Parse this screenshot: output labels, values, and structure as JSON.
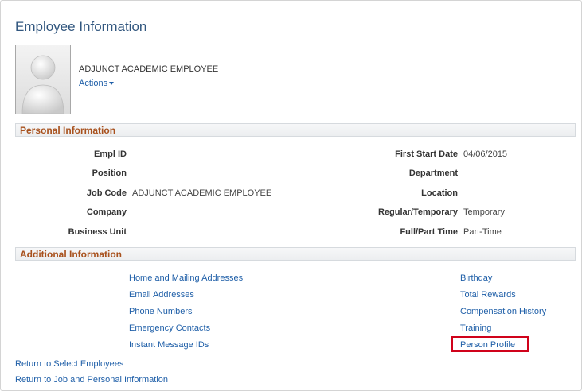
{
  "page": {
    "title": "Employee Information"
  },
  "employee": {
    "name": "ADJUNCT ACADEMIC EMPLOYEE",
    "actions_label": "Actions"
  },
  "personal": {
    "header": "Personal Information",
    "left": [
      {
        "label": "Empl ID",
        "value": ""
      },
      {
        "label": "Position",
        "value": ""
      },
      {
        "label": "Job Code",
        "value": "ADJUNCT ACADEMIC EMPLOYEE"
      },
      {
        "label": "Company",
        "value": ""
      },
      {
        "label": "Business Unit",
        "value": ""
      }
    ],
    "right": [
      {
        "label": "First Start Date",
        "value": "04/06/2015"
      },
      {
        "label": "Department",
        "value": ""
      },
      {
        "label": "Location",
        "value": ""
      },
      {
        "label": "Regular/Temporary",
        "value": "Temporary"
      },
      {
        "label": "Full/Part Time",
        "value": "Part-Time"
      }
    ]
  },
  "additional": {
    "header": "Additional Information",
    "left_links": [
      "Home and Mailing Addresses",
      "Email Addresses",
      "Phone Numbers",
      "Emergency Contacts",
      "Instant Message IDs"
    ],
    "right_links": [
      "Birthday",
      "Total Rewards",
      "Compensation History",
      "Training",
      "Person Profile"
    ]
  },
  "footer_links": [
    "Return to Select Employees",
    "Return to Job and Personal Information"
  ],
  "colors": {
    "link": "#1f5fa8",
    "section_header": "#a8511d",
    "title": "#32577f",
    "highlight": "#d0021b"
  },
  "icons": {
    "photo": "person-silhouette-icon",
    "actions": "caret-down-icon"
  }
}
